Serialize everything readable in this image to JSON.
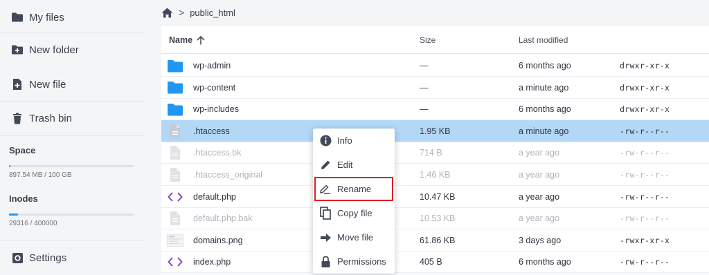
{
  "sidebar": {
    "items": [
      {
        "label": "My files",
        "icon": "folder-icon"
      },
      {
        "label": "New folder",
        "icon": "new-folder-icon"
      },
      {
        "label": "New file",
        "icon": "new-file-icon"
      },
      {
        "label": "Trash bin",
        "icon": "trash-icon"
      }
    ],
    "space": {
      "label": "Space",
      "usage_text": "897.54 MB / 100 GB",
      "fraction": 0.009
    },
    "inodes": {
      "label": "Inodes",
      "usage_text": "29316 / 400000",
      "fraction": 0.073
    },
    "settings_label": "Settings"
  },
  "breadcrumb": {
    "home_icon": "home-icon",
    "separator": ">",
    "current": "public_html"
  },
  "table": {
    "columns": {
      "name": "Name",
      "size": "Size",
      "modified": "Last modified"
    },
    "sort_icon": "arrow-up-icon",
    "rows": [
      {
        "name": "wp-admin",
        "size": "—",
        "modified": "6 months ago",
        "perms": "drwxr-xr-x",
        "type": "folder",
        "state": "normal"
      },
      {
        "name": "wp-content",
        "size": "—",
        "modified": "a minute ago",
        "perms": "drwxr-xr-x",
        "type": "folder",
        "state": "normal"
      },
      {
        "name": "wp-includes",
        "size": "—",
        "modified": "6 months ago",
        "perms": "drwxr-xr-x",
        "type": "folder",
        "state": "normal"
      },
      {
        "name": ".htaccess",
        "size": "1.95 KB",
        "modified": "a minute ago",
        "perms": "-rw-r--r--",
        "type": "file",
        "state": "selected"
      },
      {
        "name": ".htaccess.bk",
        "size": "714 B",
        "modified": "a year ago",
        "perms": "-rw-r--r--",
        "type": "file",
        "state": "dim"
      },
      {
        "name": ".htaccess_original",
        "size": "1.46 KB",
        "modified": "a year ago",
        "perms": "-rw-r--r--",
        "type": "file",
        "state": "dim"
      },
      {
        "name": "default.php",
        "size": "10.47 KB",
        "modified": "a year ago",
        "perms": "-rw-r--r--",
        "type": "code",
        "state": "normal"
      },
      {
        "name": "default.php.bak",
        "size": "10.53 KB",
        "modified": "a year ago",
        "perms": "-rw-r--r--",
        "type": "file",
        "state": "dim"
      },
      {
        "name": "domains.png",
        "size": "61.86 KB",
        "modified": "3 days ago",
        "perms": "-rwxr-xr-x",
        "type": "image",
        "state": "normal"
      },
      {
        "name": "index.php",
        "size": "405 B",
        "modified": "6 months ago",
        "perms": "-rw-r--r--",
        "type": "code",
        "state": "normal"
      }
    ]
  },
  "context_menu": {
    "items": [
      {
        "label": "Info",
        "icon": "info-icon"
      },
      {
        "label": "Edit",
        "icon": "pencil-icon"
      },
      {
        "label": "Rename",
        "icon": "rename-icon",
        "highlighted": true
      },
      {
        "label": "Copy file",
        "icon": "copy-icon"
      },
      {
        "label": "Move file",
        "icon": "arrow-right-icon"
      },
      {
        "label": "Permissions",
        "icon": "lock-icon"
      }
    ]
  },
  "colors": {
    "folder": "#2196f3",
    "code": "#8e44ad",
    "selected_row": "#b3d7f7",
    "highlight_outline": "#e01e26",
    "accent": "#2196f3"
  }
}
